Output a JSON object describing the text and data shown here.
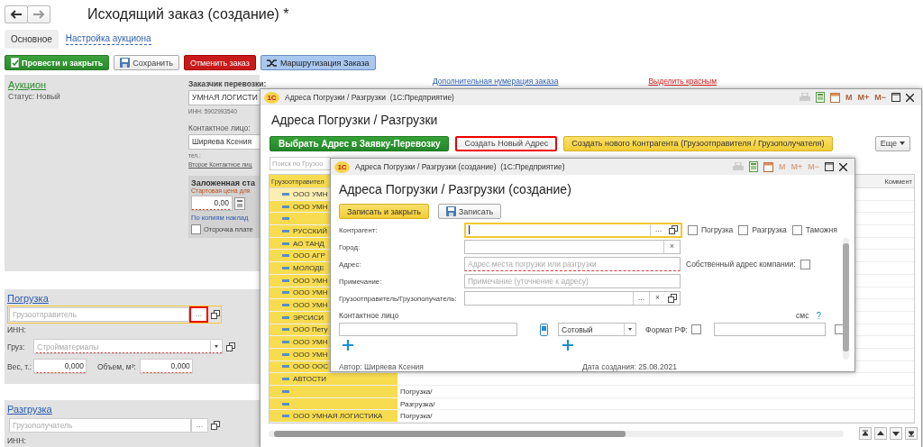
{
  "main": {
    "title": "Исходящий заказ (создание) *",
    "tabs": [
      {
        "label": "Основное",
        "selected": true
      },
      {
        "label": "Настройка аукциона",
        "selected": false
      }
    ],
    "toolbar": [
      {
        "label": "Провести и закрыть",
        "kind": "post"
      },
      {
        "label": "Сохранить",
        "kind": "save"
      },
      {
        "label": "Отменить заказ",
        "kind": "cancel"
      },
      {
        "label": "Маршрутизация Заказа",
        "kind": "route"
      }
    ],
    "links": [
      {
        "label": "Дополнительная нумерация заказа",
        "kind": "blue"
      },
      {
        "label": "Выделить красным",
        "kind": "red"
      }
    ],
    "auction": {
      "title": "Аукцион",
      "status": "Статус: Новый"
    },
    "customer": {
      "label": "Заказчик перевозки:",
      "value": "УМНАЯ ЛОГИСТИ",
      "inn": "ИНН: 5902993540",
      "contact_label": "Контактное лицо:",
      "contact_value": "Ширяева Ксения",
      "phone_label": "тел.:",
      "second_contact": "Второе Контактное лиц"
    },
    "price": {
      "title": "Заложенная ста",
      "start_label": "Стартовая цена для",
      "value": "0,00",
      "copies_link": "По копиям наклад",
      "deferral": {
        "label": "Отсрочка плате",
        "checked": false
      }
    },
    "loading": {
      "title": "Погрузка",
      "placeholder": "Грузоотправитель",
      "focused": true,
      "select_button": "...",
      "select_highlighted": true,
      "inn": "ИНН:",
      "cargo_label": "Груз:",
      "cargo_placeholder": "Стройматериалы",
      "weight_label": "Вес, т.:",
      "weight": "0,000",
      "volume_label": "Объем, м³:",
      "volume": "0,000"
    },
    "unloading": {
      "title": "Разгрузка",
      "placeholder": "Грузополучатель",
      "focused": false,
      "select_button": "...",
      "select_highlighted": false,
      "inn": "ИНН:"
    }
  },
  "addresses_window": {
    "logo": "1С",
    "title": "Адреса Погрузки / Разгрузки  (1С:Предприятие)",
    "tools": [
      "M",
      "M+",
      "M−"
    ],
    "heading": "Адреса Погрузки / Разгрузки",
    "buttons": [
      {
        "label": "Выбрать Адрес в Заявку-Перевозку",
        "kind": "primary",
        "highlighted": false
      },
      {
        "label": "Создать Новый Адрес",
        "kind": "plain",
        "highlighted": true
      },
      {
        "label": "Создать нового Контрагента (Грузоотправителя / Грузополучателя)",
        "kind": "accent",
        "highlighted": false
      }
    ],
    "more": "Еще",
    "search_placeholder": "Поиск по Грузоо",
    "columns": [
      "Грузоотправител",
      "Коммент"
    ],
    "rows": [
      {
        "shipper": "ООО УМН",
        "selected": true
      },
      {
        "shipper": "ООО УМН",
        "selected": false
      },
      {
        "selected": false
      },
      {
        "shipper": "РУССКИЙ",
        "selected": false
      },
      {
        "shipper": "АО ТАНД",
        "selected": false
      },
      {
        "shipper": "ООО АГР",
        "selected": false
      },
      {
        "shipper": "МОЛОДЕ",
        "selected": false
      },
      {
        "shipper": "ООО УМН",
        "selected": false
      },
      {
        "shipper": "ООО УМН",
        "selected": false
      },
      {
        "shipper": "ООО УМН",
        "selected": false
      },
      {
        "shipper": "ЭРСИСИ",
        "selected": false
      },
      {
        "shipper": "ООО Пету",
        "selected": false
      },
      {
        "shipper": "ООО УМН",
        "selected": false
      },
      {
        "shipper": "ООО УМН",
        "selected": false
      },
      {
        "shipper": "ООО ООС",
        "selected": false
      },
      {
        "shipper": "АВТОСТИ",
        "selected": false
      },
      {
        "direction": "Погрузка/",
        "selected": false
      },
      {
        "direction": "Разгрузка/",
        "selected": false
      },
      {
        "shipper": "ООО УМНАЯ ЛОГИСТИКА",
        "direction": "Погрузка/",
        "selected": false
      }
    ]
  },
  "create_window": {
    "logo": "1С",
    "title": "Адреса Погрузки / Разгрузки (создание)  (1С:Предприятие)",
    "tools": [
      "M",
      "M+",
      "M−"
    ],
    "heading": "Адреса Погрузки / Разгрузки (создание)",
    "buttons": [
      {
        "label": "Записать и закрыть",
        "kind": "primary"
      },
      {
        "label": "Записать",
        "kind": "save"
      }
    ],
    "counterparty": {
      "label": "Контрагент:",
      "focused": true,
      "select_button": "..."
    },
    "flags": [
      {
        "label": "Погрузка",
        "checked": false
      },
      {
        "label": "Разгрузка",
        "checked": false
      },
      {
        "label": "Таможня",
        "checked": false
      }
    ],
    "city": {
      "label": "Город:",
      "clear_button": "×"
    },
    "address": {
      "label": "Адрес:",
      "placeholder": "Адрес места погрузки или разгрузки"
    },
    "own_address": {
      "label": "Собственный адрес компании:",
      "checked": false
    },
    "note": {
      "label": "Примечание:",
      "placeholder": "Примечание (уточнение к адресу)"
    },
    "shipper": {
      "label": "Грузоотправитель/Грузополучатель:",
      "select_button": "...",
      "clear_button": "×"
    },
    "contact_label": "Контактное лицо",
    "sms_label": "смс",
    "help": "?",
    "phone_type": "Сотовый",
    "rf_format": {
      "label": "Формат РФ:",
      "checked": false
    },
    "sms_checked": false,
    "author": "Автор: Ширяева Ксения",
    "created": "Дата создания: 25.08.2021"
  }
}
